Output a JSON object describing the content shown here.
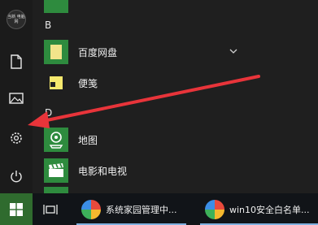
{
  "rail": {
    "avatar_text": "当新 电脑网"
  },
  "app_list": {
    "groups": [
      {
        "letter": "B"
      },
      {
        "letter": "D"
      }
    ],
    "items": [
      {
        "label": "百度网盘"
      },
      {
        "label": "便笺"
      },
      {
        "label": "地图"
      },
      {
        "label": "电影和电视"
      }
    ]
  },
  "taskbar": {
    "apps": [
      {
        "label": "系统家园管理中..."
      },
      {
        "label": "win10安全白名单..."
      }
    ]
  },
  "colors": {
    "tile_green": "#2e8b3e",
    "start_green": "#2f6b2e",
    "arrow_red": "#e8343a"
  }
}
